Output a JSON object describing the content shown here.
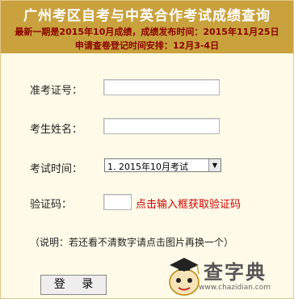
{
  "header": {
    "title": "广州考区自考与中英合作考试成绩查询",
    "notice_line1": "最新一期是2015年10月成绩，成绩发布时间：2015年11月25日",
    "notice_line2": "申请查卷登记时间安排：12月3-4日"
  },
  "form": {
    "ticket_label": "准考证号：",
    "ticket_value": "",
    "name_label": "考生姓名：",
    "name_value": "",
    "exam_time_label": "考试时间：",
    "exam_time_selected": "1. 2015年10月考试",
    "captcha_label": "验证码：",
    "captcha_value": "",
    "captcha_hint": "点击输入框获取验证码",
    "note": "（说明：若还看不清数字请点击图片再换一个）",
    "login_label": "登 录"
  },
  "watermark": {
    "brand": "查字典",
    "url": "www.chazidian.com"
  },
  "colors": {
    "banner": "#c9a23e",
    "notice_text": "#8b0000",
    "hint_red": "#d20000",
    "background": "#fffbe8"
  }
}
